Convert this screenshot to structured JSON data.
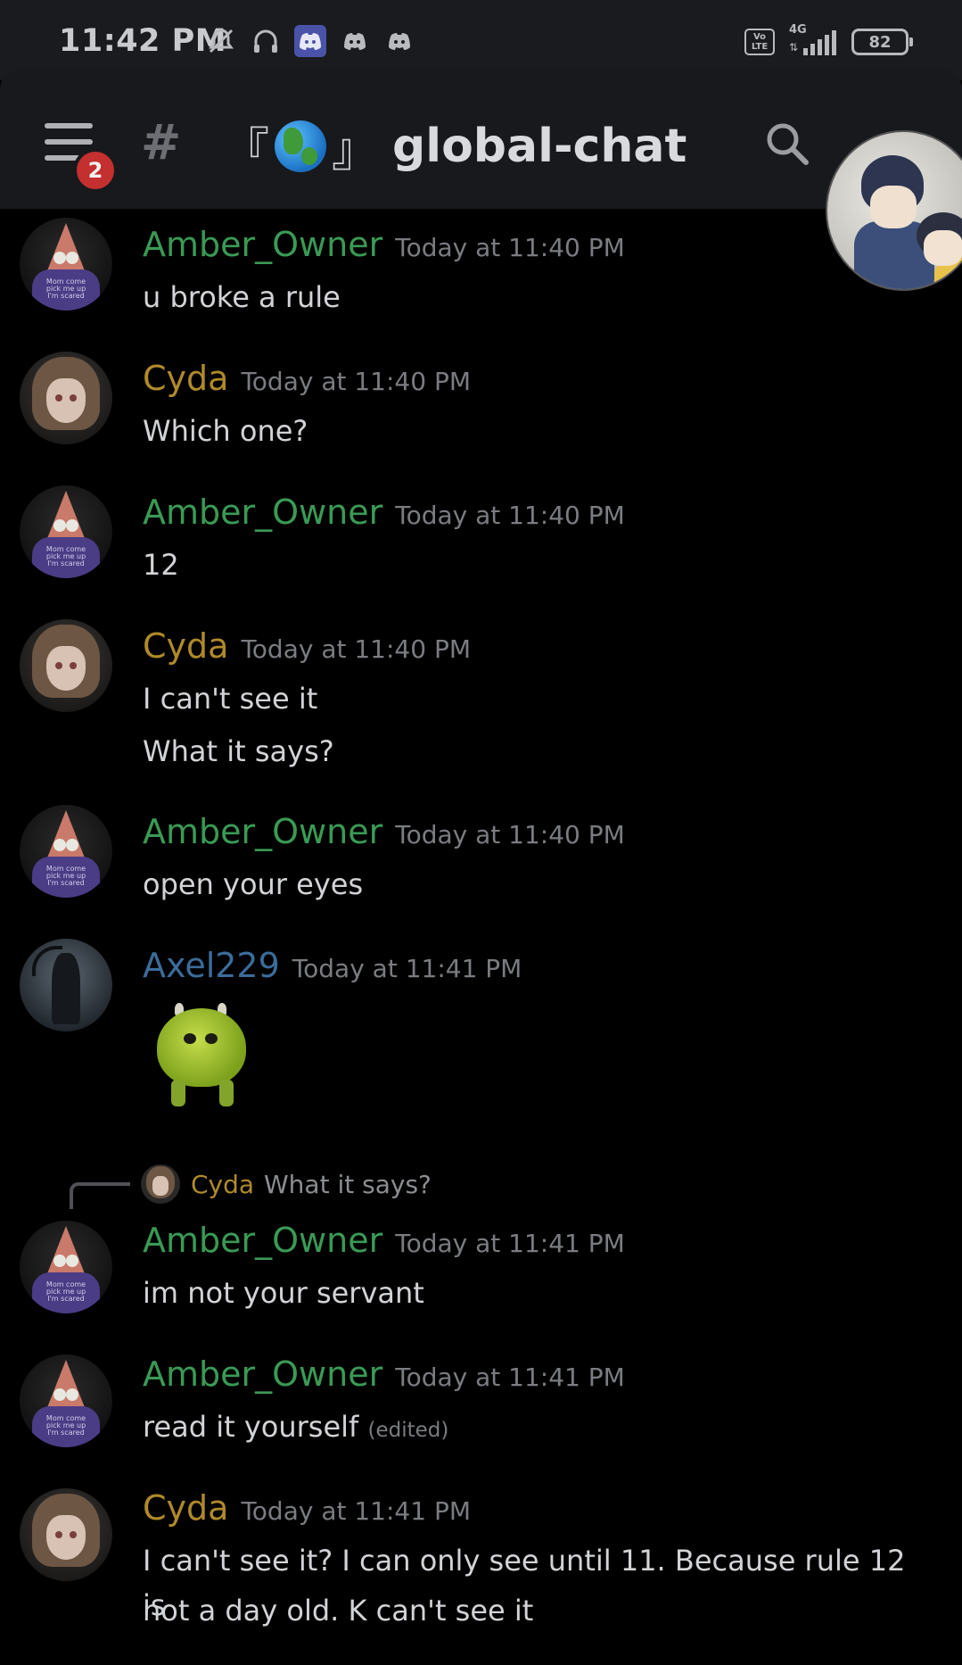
{
  "status_bar": {
    "time": "11:42 PM",
    "volte_label": "Vo LTE",
    "network_type": "4G",
    "battery": "82"
  },
  "header": {
    "notification_count": "2",
    "channel_prefix_open": "『",
    "channel_prefix_close": "』",
    "channel_name": "global-chat"
  },
  "messages": [
    {
      "author": "Amber_Owner",
      "timestamp": "Today at 11:40 PM",
      "lines": [
        "u broke a rule"
      ]
    },
    {
      "author": "Cyda",
      "timestamp": "Today at 11:40 PM",
      "lines": [
        "Which one?"
      ]
    },
    {
      "author": "Amber_Owner",
      "timestamp": "Today at 11:40 PM",
      "lines": [
        "12"
      ]
    },
    {
      "author": "Cyda",
      "timestamp": "Today at 11:40 PM",
      "lines": [
        "I can't see it",
        "What it says?"
      ]
    },
    {
      "author": "Amber_Owner",
      "timestamp": "Today at 11:40 PM",
      "lines": [
        "open your eyes"
      ]
    },
    {
      "author": "Axel229",
      "timestamp": "Today at 11:41 PM",
      "sticker": "mike-wazowski-sticker"
    },
    {
      "author": "Amber_Owner",
      "timestamp": "Today at 11:41 PM",
      "lines": [
        "im not your servant"
      ],
      "reply_to": {
        "author": "Cyda",
        "text": "What it says?"
      }
    },
    {
      "author": "Amber_Owner",
      "timestamp": "Today at 11:41 PM",
      "lines": [
        "read it yourself"
      ],
      "edited": "(edited)"
    },
    {
      "author": "Cyda",
      "timestamp": "Today at 11:41 PM",
      "lines": [
        "I can't see it? I can only see until 11. Because rule 12 is",
        "not a day old. K can't see it"
      ]
    }
  ],
  "colors": {
    "background": "#000000",
    "header_bg": "#18191c",
    "amber_owner": "#3a9a55",
    "cyda": "#b08a2a",
    "axel229": "#3b6c9a",
    "badge": "#c3302f"
  },
  "icons": [
    "mute-bell-icon",
    "headset-icon",
    "discord-icon",
    "menu-icon",
    "hash-icon",
    "globe-emoji",
    "search-icon",
    "user-avatar-icon"
  ]
}
